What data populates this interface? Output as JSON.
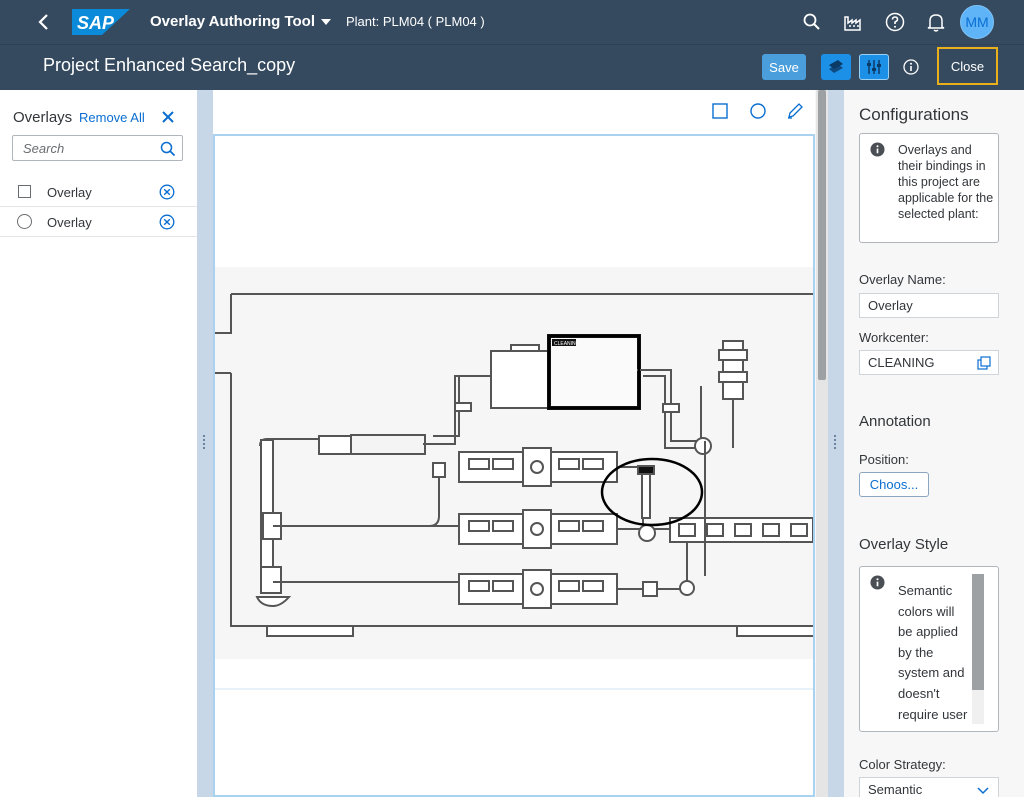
{
  "shell": {
    "app_title": "Overlay Authoring Tool",
    "plant_label": "Plant: PLM04 ( PLM04 )",
    "logo_text": "SAP",
    "avatar_initials": "MM",
    "brand_color": "#354a5f"
  },
  "header": {
    "page_title": "Project Enhanced Search_copy",
    "save_label": "Save",
    "close_label": "Close"
  },
  "overlays_panel": {
    "title": "Overlays",
    "remove_all_label": "Remove All",
    "search_placeholder": "Search",
    "items": [
      {
        "name": "Overlay",
        "shape_icon": "rectangle-icon"
      },
      {
        "name": "Overlay",
        "shape_icon": "circle-icon"
      }
    ]
  },
  "canvas": {
    "tools": [
      "rectangle-tool-icon",
      "circle-tool-icon",
      "freehand-pen-icon"
    ],
    "overlay_label": "CLEANING"
  },
  "config": {
    "title": "Configurations",
    "info_text": "Overlays and their bindings in this project are applicable for the selected plant:",
    "overlay_name_label": "Overlay Name:",
    "overlay_name_value": "Overlay",
    "workcenter_label": "Workcenter:",
    "workcenter_value": "CLEANING",
    "annotation_title": "Annotation",
    "position_label": "Position:",
    "choose_label": "Choos...",
    "overlay_style_title": "Overlay Style",
    "style_text": "Semantic colors will be applied by the system and doesn't require user",
    "color_strategy_label": "Color Strategy:",
    "color_strategy_value": "Semantic"
  },
  "colors": {
    "accent": "#0a6ed1",
    "highlight_border": "#e9b01b",
    "canvas_border": "#a9d1f0"
  }
}
